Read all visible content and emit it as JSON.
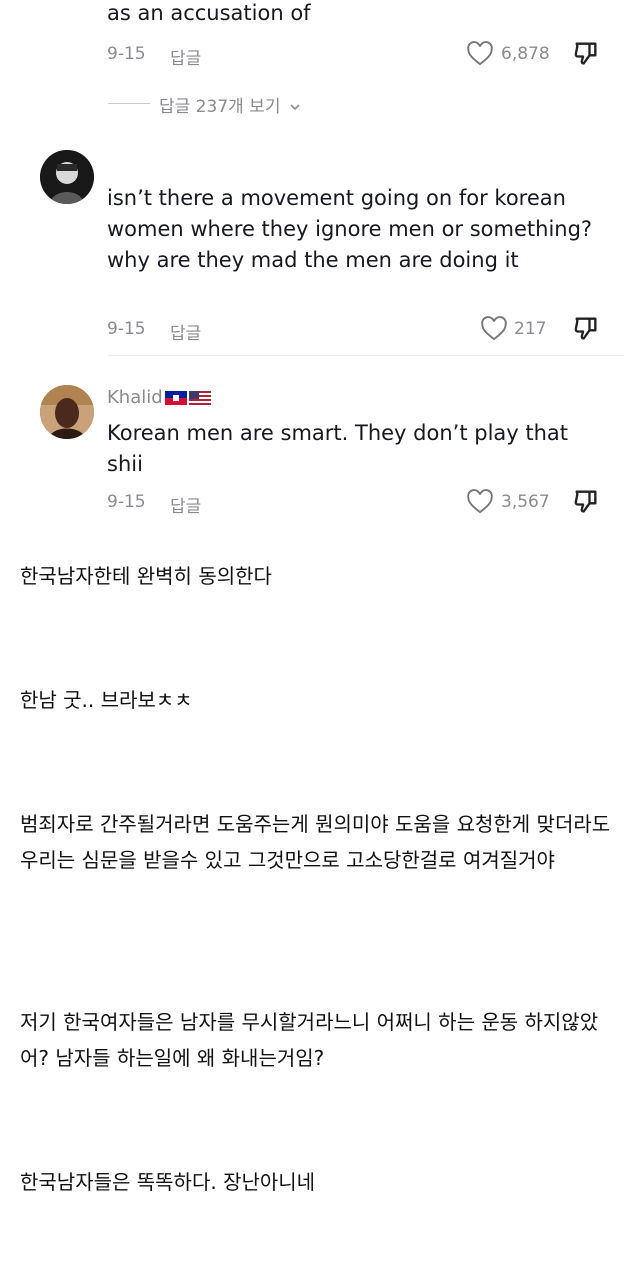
{
  "comment1": {
    "text_tail": "as an accusation of",
    "date": "9-15",
    "reply_label": "답글",
    "likes": "6,878",
    "view_replies": "답글 237개 보기"
  },
  "comment2": {
    "text": "isn’t there a movement going on for korean women where they ignore men or something? why are they mad the men are doing it",
    "date": "9-15",
    "reply_label": "답글",
    "likes": "217"
  },
  "comment3": {
    "username": "Khalid",
    "flags": [
      "Haiti flag",
      "US flag"
    ],
    "text": "Korean men are smart. They don’t play that shii",
    "date": "9-15",
    "reply_label": "답글",
    "likes": "3,567"
  },
  "translations": [
    "한국남자한테 완벽히 동의한다",
    "한남 굿.. 브라보ㅊㅊ",
    "범죄자로 간주될거라면 도움주는게 뭔의미야 도움을 요청한게 맞더라도 우리는 심문을 받을수 있고 그것만으로 고소당한걸로 여겨질거야",
    "저기 한국여자들은 남자를 무시할거라느니 어쩌니 하는 운동 하지않았어? 남자들 하는일에 왜 화내는거임?",
    "한국남자들은 똑똑하다. 장난아니네"
  ],
  "icons": {
    "like": "heart-outline-icon",
    "dislike": "thumbs-down-icon",
    "chevron": "chevron-down-icon"
  },
  "colors": {
    "text": "#161823",
    "muted": "#8a8b91"
  }
}
